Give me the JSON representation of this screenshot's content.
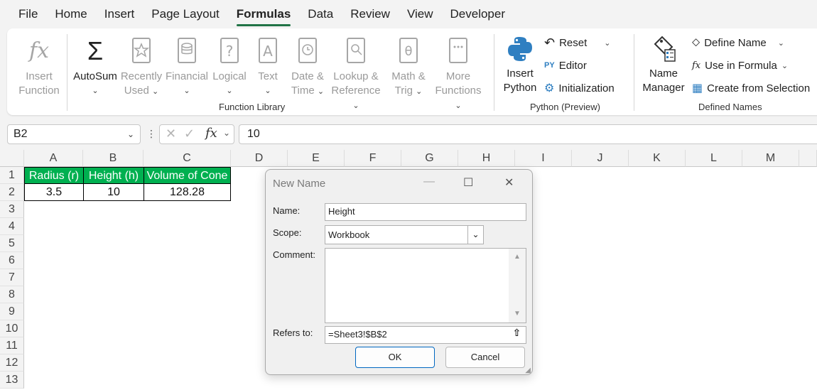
{
  "menu": {
    "items": [
      "File",
      "Home",
      "Insert",
      "Page Layout",
      "Formulas",
      "Data",
      "Review",
      "View",
      "Developer"
    ],
    "active": "Formulas"
  },
  "ribbon": {
    "function_library": {
      "label": "Function Library",
      "insert_function": [
        "Insert",
        "Function"
      ],
      "autosum": "AutoSum",
      "recently_used": [
        "Recently",
        "Used"
      ],
      "financial": "Financial",
      "logical": "Logical",
      "text": "Text",
      "date_time": [
        "Date &",
        "Time"
      ],
      "lookup_reference": [
        "Lookup &",
        "Reference"
      ],
      "math_trig": [
        "Math &",
        "Trig"
      ],
      "more_functions": [
        "More",
        "Functions"
      ]
    },
    "python": {
      "label": "Python (Preview)",
      "insert_python": [
        "Insert",
        "Python"
      ],
      "reset": "Reset",
      "editor": "Editor",
      "initialization": "Initialization"
    },
    "defined_names": {
      "label": "Defined Names",
      "name_manager": [
        "Name",
        "Manager"
      ],
      "define_name": "Define Name",
      "use_in_formula": "Use in Formula",
      "create_from_selection": "Create from Selection"
    }
  },
  "formula_bar": {
    "name_box": "B2",
    "value": "10"
  },
  "sheet": {
    "columns": [
      "A",
      "B",
      "C",
      "D",
      "E",
      "F",
      "G",
      "H",
      "I",
      "J",
      "K",
      "L",
      "M"
    ],
    "rows": [
      "1",
      "2",
      "3",
      "4",
      "5",
      "6",
      "7",
      "8",
      "9",
      "10",
      "11",
      "12",
      "13"
    ],
    "headers": [
      "Radius (r)",
      "Height (h)",
      "Volume of Cone"
    ],
    "values": [
      "3.5",
      "10",
      "128.28"
    ],
    "header_color": "#00b050"
  },
  "dialog": {
    "title": "New Name",
    "name_label": "Name:",
    "name_value": "Height",
    "scope_label": "Scope:",
    "scope_value": "Workbook",
    "comment_label": "Comment:",
    "comment_value": "",
    "refers_label": "Refers to:",
    "refers_value": "=Sheet3!$B$2",
    "ok": "OK",
    "cancel": "Cancel"
  }
}
